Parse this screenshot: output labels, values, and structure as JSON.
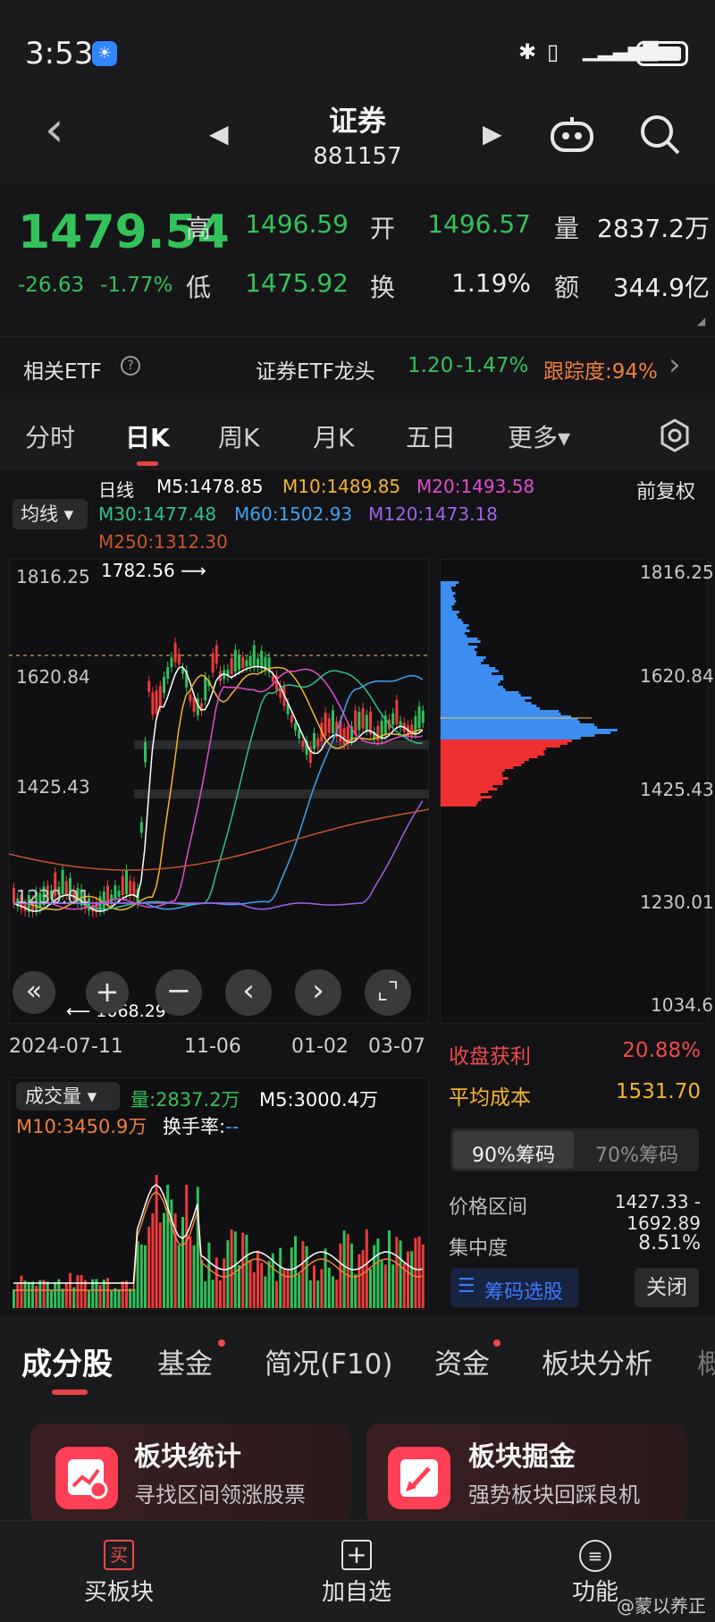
{
  "status": {
    "time": "3:53",
    "weather_icon": "weather-cloud-sun-icon"
  },
  "nav": {
    "title": "证券",
    "code": "881157"
  },
  "quote": {
    "price": "1479.54",
    "change": "-26.63",
    "change_pct": "-1.77%",
    "high_label": "高",
    "high": "1496.59",
    "open_label": "开",
    "open": "1496.57",
    "volume_label": "量",
    "volume": "2837.2万",
    "low_label": "低",
    "low": "1475.92",
    "turnover_label": "换",
    "turnover": "1.19%",
    "amount_label": "额",
    "amount": "344.9亿"
  },
  "etf": {
    "label": "相关ETF",
    "help": "?",
    "name": "证券ETF龙头",
    "price": "1.20",
    "change_pct": "-1.47%",
    "tracking": "跟踪度:94%"
  },
  "tabs": [
    "分时",
    "日K",
    "周K",
    "月K",
    "五日",
    "更多▾"
  ],
  "chart": {
    "period_label": "日线",
    "avg_button": "均线",
    "adjust": "前复权",
    "ma": {
      "m5": "M5:1478.85",
      "m10": "M10:1489.85",
      "m20": "M20:1493.58",
      "m30": "M30:1477.48",
      "m60": "M60:1502.93",
      "m120": "M120:1473.18",
      "m250": "M250:1312.30"
    },
    "ma_colors": {
      "m5": "#ffffff",
      "m10": "#f5b52d",
      "m20": "#e44bd0",
      "m30": "#2fc286",
      "m60": "#3fa3ef",
      "m120": "#a062e8",
      "m250": "#c9562a"
    },
    "price_axis": [
      "1816.25",
      "1620.84",
      "1425.43",
      "1230.01"
    ],
    "high_mark": "1782.56",
    "low_mark": "1068.29",
    "dist_axis": [
      "1816.25",
      "1620.84",
      "1425.43",
      "1230.01",
      "1034.6"
    ],
    "dates": [
      "2024-07-11",
      "11-06",
      "01-02",
      "03-07"
    ]
  },
  "volume": {
    "button": "成交量",
    "qty": "量:2837.2万",
    "m5": "M5:3000.4万",
    "m10": "M10:3450.9万",
    "turnover": "换手率:",
    "turnover_value": "--"
  },
  "chips": {
    "profit_label": "收盘获利",
    "profit": "20.88%",
    "cost_label": "平均成本",
    "cost": "1531.70",
    "seg_on": "90%筹码",
    "seg_off": "70%筹码",
    "range_label": "价格区间",
    "range": "1427.33 - 1692.89",
    "conc_label": "集中度",
    "conc": "8.51%",
    "pick": "筹码选股",
    "close": "关闭"
  },
  "bottom_tabs": [
    "成分股",
    "基金",
    "简况(F10)",
    "资金",
    "板块分析",
    "概"
  ],
  "cards": [
    {
      "title": "板块统计",
      "sub": "寻找区间领涨股票"
    },
    {
      "title": "板块掘金",
      "sub": "强势板块回踩良机"
    }
  ],
  "footer": {
    "buy_icon": "买",
    "buy": "买板块",
    "add": "加自选",
    "func": "功能"
  },
  "watermark": "@蒙以养正"
}
